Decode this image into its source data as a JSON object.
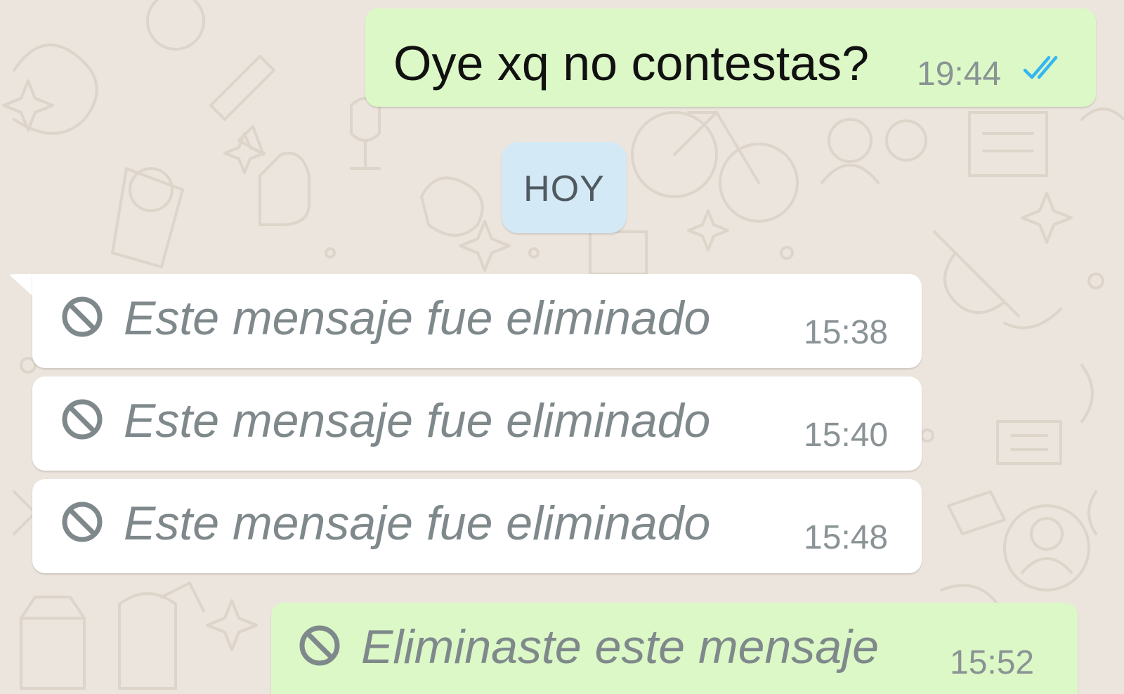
{
  "chat": {
    "messages": [
      {
        "direction": "outgoing",
        "text": "Oye xq no contestas?",
        "time": "19:44",
        "status": "read",
        "status_icon": "double-check-icon",
        "deleted": false
      },
      {
        "direction": "incoming",
        "text": "Este mensaje fue eliminado",
        "time": "15:38",
        "deleted": true,
        "icon": "ban-icon"
      },
      {
        "direction": "incoming",
        "text": "Este mensaje fue eliminado",
        "time": "15:40",
        "deleted": true,
        "icon": "ban-icon"
      },
      {
        "direction": "incoming",
        "text": "Este mensaje fue eliminado",
        "time": "15:48",
        "deleted": true,
        "icon": "ban-icon"
      },
      {
        "direction": "outgoing",
        "text": "Eliminaste este mensaje",
        "time": "15:52",
        "deleted": true,
        "icon": "ban-icon"
      }
    ],
    "date_separator": "HOY"
  },
  "colors": {
    "background": "#ECE5DD",
    "outgoing_bubble": "#DCF8C6",
    "incoming_bubble": "#FFFFFF",
    "date_chip": "#D4E9F6",
    "read_ticks": "#34B7F1",
    "deleted_text": "#7F898C",
    "time_text": "#8A9395"
  }
}
